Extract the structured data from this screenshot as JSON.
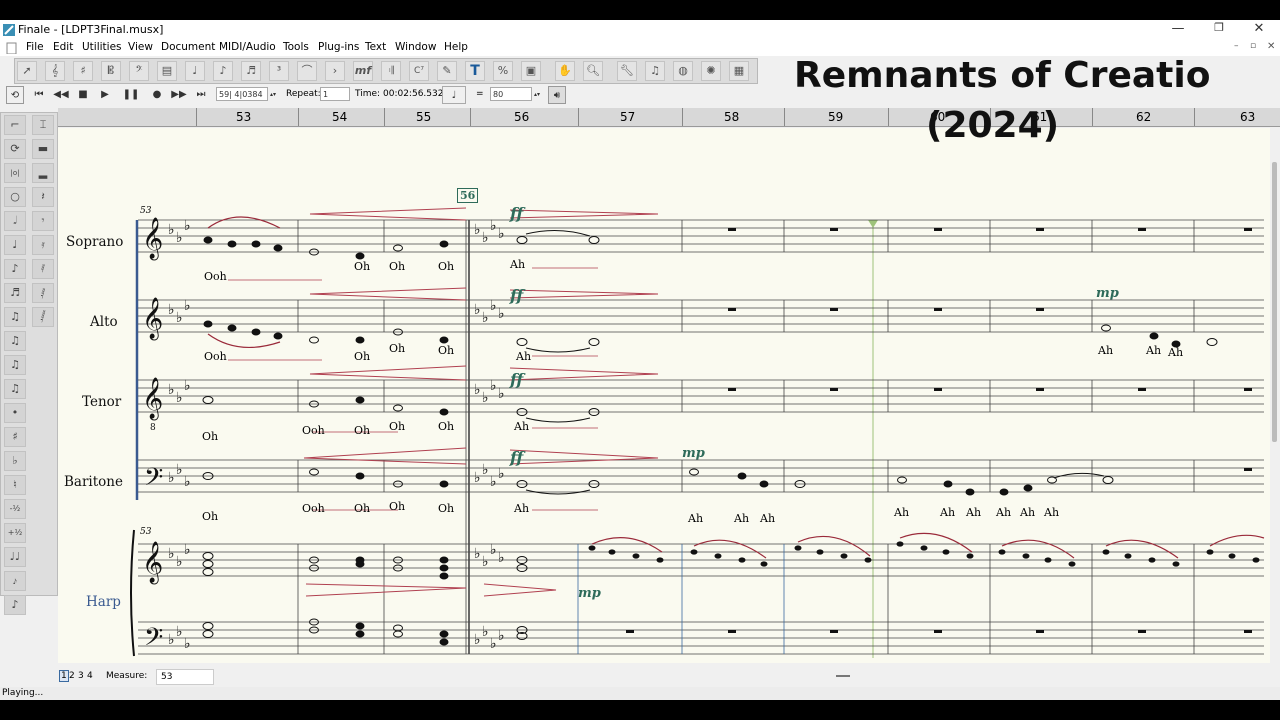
{
  "window": {
    "title": "Finale - [LDPT3Final.musx]"
  },
  "menu": {
    "items": [
      "File",
      "Edit",
      "Utilities",
      "View",
      "Document",
      "MIDI/Audio",
      "Tools",
      "Plug-ins",
      "Text",
      "Window",
      "Help"
    ]
  },
  "playback": {
    "counter": "59| 4|0384",
    "repeat_label": "Repeat:",
    "repeat_value": "1",
    "time_label": "Time:",
    "time_value": "00:02:56.532",
    "equals": "=",
    "tempo": "80"
  },
  "ruler": {
    "measures": [
      "53",
      "54",
      "55",
      "56",
      "57",
      "58",
      "59",
      "60",
      "61",
      "62",
      "63"
    ]
  },
  "overlay": {
    "title_line1": "Remnants of Creatio",
    "title_line2": "(2024)"
  },
  "score": {
    "start_measure": "53",
    "rehearsal_mark": "56",
    "staves": [
      {
        "name": "Soprano",
        "lyrics": [
          "Ooh",
          "Oh",
          "Oh",
          "Oh",
          "Ah"
        ],
        "dynamics": [
          "ff"
        ]
      },
      {
        "name": "Alto",
        "lyrics": [
          "Ooh",
          "Oh",
          "Oh",
          "Oh",
          "Ah",
          "Ah",
          "Ah",
          "Ah"
        ],
        "dynamics": [
          "ff",
          "mp"
        ]
      },
      {
        "name": "Tenor",
        "lyrics": [
          "Oh",
          "Ooh",
          "Oh",
          "Oh",
          "Oh",
          "Ah"
        ],
        "dynamics": [
          "ff"
        ]
      },
      {
        "name": "Baritone",
        "lyrics": [
          "Oh",
          "Ooh",
          "Oh",
          "Oh",
          "Oh",
          "Ah",
          "Ah",
          "Ah",
          "Ah",
          "Ah",
          "Ah",
          "Ah",
          "Ah",
          "Ah",
          "Ah"
        ],
        "dynamics": [
          "ff",
          "mp"
        ]
      },
      {
        "name": "Harp",
        "dynamics": [
          "mp"
        ]
      }
    ]
  },
  "bottom": {
    "pages": [
      "1",
      "2",
      "3",
      "4"
    ],
    "measure_label": "Measure:",
    "measure_value": "53"
  },
  "status": {
    "text": "Playing..."
  },
  "colors": {
    "dynamic": "#2e6b5a",
    "hairpin": "#b04050",
    "harp_label": "#3a5a90",
    "playhead": "#9ec37a"
  }
}
